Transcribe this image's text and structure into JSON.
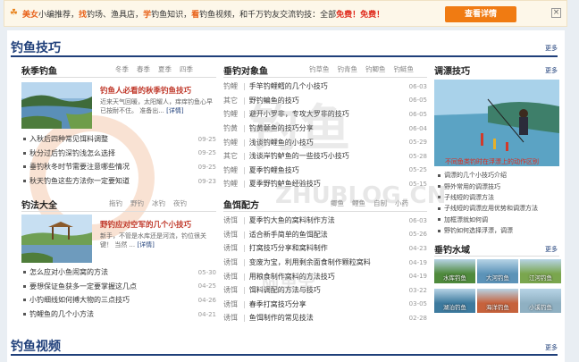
{
  "promo": {
    "parts": [
      {
        "text": "美女",
        "style": "hl"
      },
      {
        "text": "小编推荐，",
        "style": "n"
      },
      {
        "text": "找",
        "style": "hl"
      },
      {
        "text": "钓场、渔具店，",
        "style": "n"
      },
      {
        "text": "学",
        "style": "hl"
      },
      {
        "text": "钓鱼知识，",
        "style": "n"
      },
      {
        "text": "看",
        "style": "hl"
      },
      {
        "text": "钓鱼视频，和千万钓友交流钓技：全部",
        "style": "n"
      },
      {
        "text": "免费！免费！",
        "style": "red"
      }
    ],
    "button": "查看详情",
    "close": "×"
  },
  "section1": {
    "title": "钓鱼技巧",
    "more": "更多"
  },
  "section2": {
    "title": "钓鱼视频",
    "more": "更多"
  },
  "autumn": {
    "title": "秋季钓鱼",
    "tabs": [
      "冬季",
      "春季",
      "夏季",
      "四季"
    ],
    "feature": {
      "title": "钓鱼人必看的秋季钓鱼技巧",
      "desc": "近来天气回暖，太阳耀人，痒痒钓鱼心早已按耐不住。 准备出...",
      "more": "[详情]"
    },
    "list": [
      {
        "text": "入秋后四种常见饵料调整",
        "date": "09-25"
      },
      {
        "text": "秋分过后钓深钓浅怎么选择",
        "date": "09-25"
      },
      {
        "text": "垂钓秋冬时节需要注意哪些情况",
        "date": "09-25"
      },
      {
        "text": "秋天钓鱼这些方法你一定要知道",
        "date": "09-23"
      }
    ]
  },
  "methods": {
    "title": "钓法大全",
    "tabs": [
      "拖钓",
      "野钓",
      "冰钓",
      "夜钓"
    ],
    "feature": {
      "title": "野钓应对空军的几个小技巧",
      "desc": "新手，不管是水库还是河流，钓位很关键！ 当然 ...",
      "more": "[详情]"
    },
    "list": [
      {
        "text": "怎么应对小鱼闹窝的方法",
        "date": "05-30"
      },
      {
        "text": "要想保证鱼获多一定要掌握这几点",
        "date": "04-25"
      },
      {
        "text": "小钓细线如何搏大物的三点技巧",
        "date": "04-26"
      },
      {
        "text": "钓鲤鱼的几个小方法",
        "date": "04-21"
      }
    ]
  },
  "targets": {
    "title": "垂钓对象鱼",
    "tabs": [
      "钓草鱼",
      "钓青鱼",
      "钓鲫鱼",
      "钓鲢鱼"
    ],
    "list": [
      {
        "cat": "钓鲤",
        "text": "手竿钓鲤鳕的几个小技巧",
        "date": "06-03"
      },
      {
        "cat": "其它",
        "text": "野钓鳊鱼的技巧",
        "date": "06-05"
      },
      {
        "cat": "钓鲤",
        "text": "避开小罗非，专攻大罗非的技巧",
        "date": "06-05"
      },
      {
        "cat": "钓黄",
        "text": "钓黄颡鱼的技巧分享",
        "date": "06-04"
      },
      {
        "cat": "钓鲤",
        "text": "浅谈钓鲤鱼的小技巧",
        "date": "05-29"
      },
      {
        "cat": "其它",
        "text": "浅谈岸钓鲈鱼的一些技巧小技巧",
        "date": "05-28"
      },
      {
        "cat": "钓鲤",
        "text": "夏季钓鲤鱼技巧",
        "date": "05-25"
      },
      {
        "cat": "钓鲤",
        "text": "夏季野钓鲈鱼经验技巧",
        "date": "05-15"
      }
    ]
  },
  "bait": {
    "title": "鱼饵配方",
    "tabs": [
      "鲫鱼",
      "鲤鱼",
      "自制",
      "小药"
    ],
    "list": [
      {
        "cat": "诱饵",
        "text": "夏季钓大鱼的窝料制作方法",
        "date": "06-03"
      },
      {
        "cat": "诱饵",
        "text": "适合新手简单的鱼饵配法",
        "date": "05-26"
      },
      {
        "cat": "诱饵",
        "text": "打窝技巧分享和窝料制作",
        "date": "04-23"
      },
      {
        "cat": "诱饵",
        "text": "变废为宝，利用剩余面食制作颗粒窝料",
        "date": "04-19"
      },
      {
        "cat": "诱饵",
        "text": "用粮食制作窝料的方法技巧",
        "date": "04-19"
      },
      {
        "cat": "诱饵",
        "text": "饵料调配的方法与技巧",
        "date": "03-22"
      },
      {
        "cat": "诱饵",
        "text": "春季打窝技巧分享",
        "date": "03-05"
      },
      {
        "cat": "诱饵",
        "text": "鱼饵制作的常见技法",
        "date": "02-28"
      }
    ]
  },
  "tips": {
    "title": "调漂技巧",
    "more": "更多",
    "caption": "不同鱼类钓时在浮漂上的动作区别",
    "list": [
      "调漂的几个小技巧介绍",
      "野外常用的调漂技巧",
      "子线短的调漂方法",
      "子线短的调漂应用优势和调漂方法",
      "加框漂就如何调",
      "野钓如何选择浮漂，调漂"
    ]
  },
  "waters": {
    "title": "垂钓水域",
    "more": "更多",
    "items": [
      "水库钓鱼",
      "大河钓鱼",
      "江河钓鱼",
      "湖泊钓鱼",
      "海洋钓鱼",
      "小溪钓鱼"
    ]
  },
  "watermark": {
    "main": "钓鱼",
    "sub": "ZHUBLOG.CN",
    "brand": "阿里宝"
  },
  "colors": {
    "accent": "#f07b12",
    "title": "#1f3f7a",
    "highlight": "#c0392b"
  }
}
